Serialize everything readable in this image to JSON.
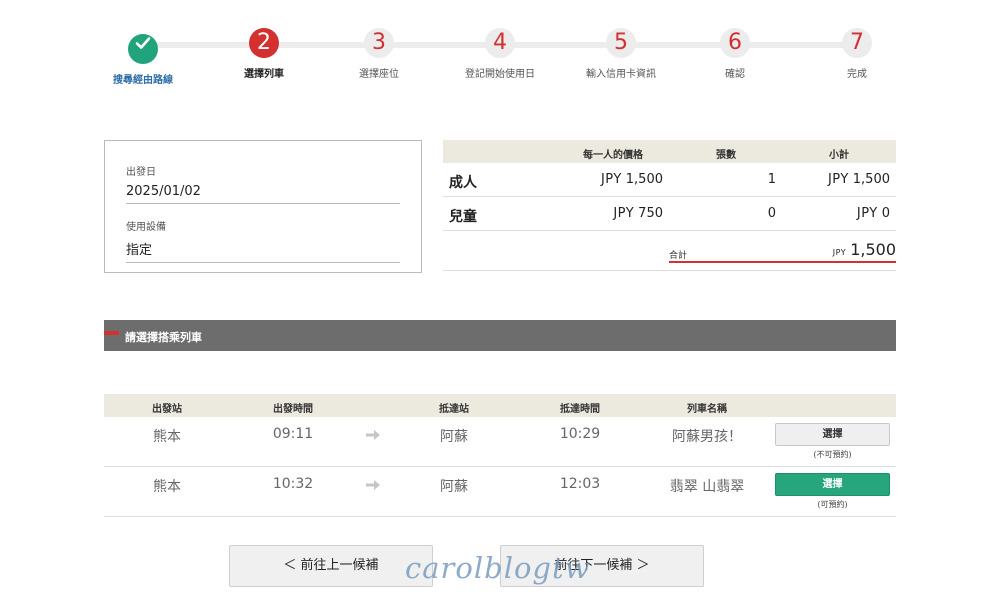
{
  "stepper": {
    "steps": [
      {
        "number": "",
        "label": "搜尋經由路線",
        "state": "done"
      },
      {
        "number": "2",
        "label": "選擇列車",
        "state": "current"
      },
      {
        "number": "3",
        "label": "選擇座位",
        "state": "todo"
      },
      {
        "number": "4",
        "label": "登記開始使用日",
        "state": "todo"
      },
      {
        "number": "5",
        "label": "輸入信用卡資訊",
        "state": "todo"
      },
      {
        "number": "6",
        "label": "確認",
        "state": "todo"
      },
      {
        "number": "7",
        "label": "完成",
        "state": "todo"
      }
    ],
    "colors": {
      "done": "#21a37b",
      "current": "#d3312f",
      "todo_text": "#d23030"
    }
  },
  "info": {
    "departure_date_label": "出發日",
    "departure_date": "2025/01/02",
    "facility_label": "使用設備",
    "facility": "指定"
  },
  "price": {
    "headers": {
      "per_person": "每一人的價格",
      "count": "張數",
      "subtotal": "小計"
    },
    "currency": "JPY",
    "rows": [
      {
        "type": "成人",
        "per_person": "1,500",
        "count": "1",
        "subtotal": "1,500"
      },
      {
        "type": "兒童",
        "per_person": "750",
        "count": "0",
        "subtotal": "0"
      }
    ],
    "total_label": "合計",
    "total": "1,500"
  },
  "section": {
    "title": "請選擇搭乘列車"
  },
  "trains": {
    "headers": {
      "from": "出發站",
      "depart": "出發時間",
      "to": "抵達站",
      "arrive": "抵達時間",
      "name": "列車名稱"
    },
    "rows": [
      {
        "from": "熊本",
        "depart": "09:11",
        "to": "阿蘇",
        "arrive": "10:29",
        "name": "阿蘇男孩！",
        "button": "選擇",
        "note": "(不可預約)",
        "available": false
      },
      {
        "from": "熊本",
        "depart": "10:32",
        "to": "阿蘇",
        "arrive": "12:03",
        "name": "翡翠 山翡翠",
        "button": "選擇",
        "note": "(可預約)",
        "available": true
      }
    ]
  },
  "nav": {
    "prev": "＜ 前往上一候補",
    "next": "前往下一候補 ＞"
  },
  "watermark": "carolblogtw"
}
